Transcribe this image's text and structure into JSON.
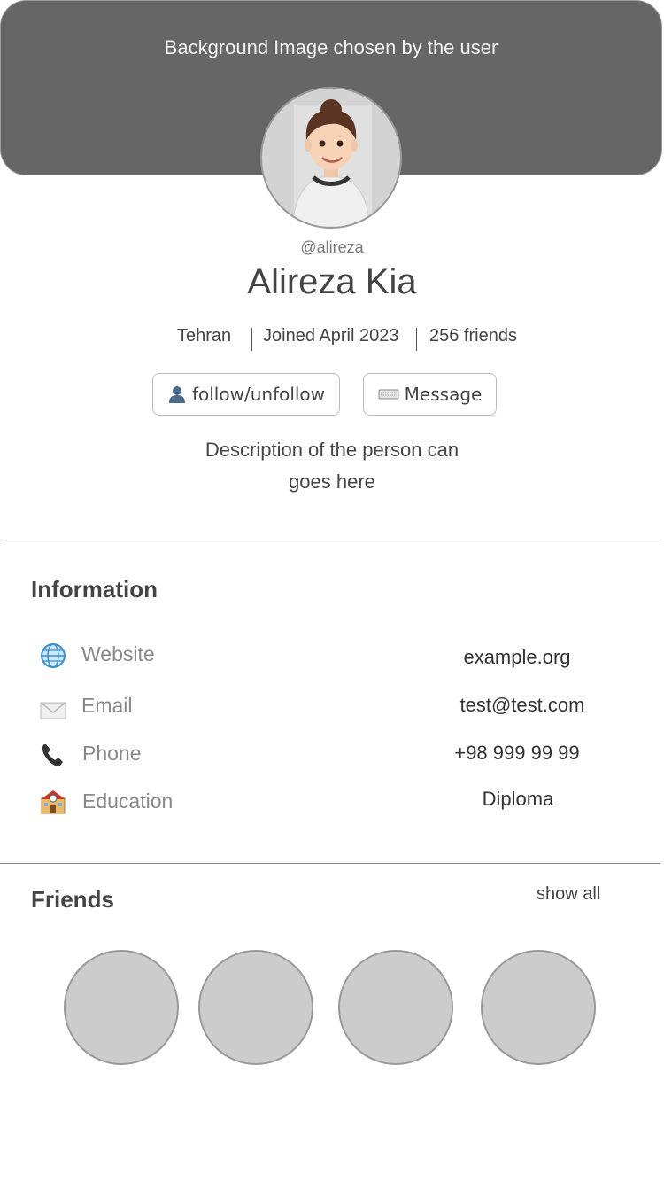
{
  "header": {
    "background_text": "Background Image chosen by the user"
  },
  "profile": {
    "handle": "@alireza",
    "name": "Alireza Kia",
    "location": "Tehran",
    "joined": "Joined April 2023",
    "friends_count": "256 friends",
    "description_line1": "Description of the person can",
    "description_line2": "goes here"
  },
  "actions": {
    "follow_label": "follow/unfollow",
    "message_label": "Message"
  },
  "information": {
    "title": "Information",
    "rows": [
      {
        "icon": "globe-icon",
        "label": "Website",
        "value": "example.org"
      },
      {
        "icon": "envelope-icon",
        "label": "Email",
        "value": "test@test.com"
      },
      {
        "icon": "phone-icon",
        "label": "Phone",
        "value": "+98 999 99 99"
      },
      {
        "icon": "school-icon",
        "label": "Education",
        "value": "Diploma"
      }
    ]
  },
  "friends": {
    "title": "Friends",
    "show_all": "show all",
    "count_shown": 4
  },
  "colors": {
    "cover": "#666666",
    "placeholder": "#cccccc",
    "divider": "#888888"
  }
}
